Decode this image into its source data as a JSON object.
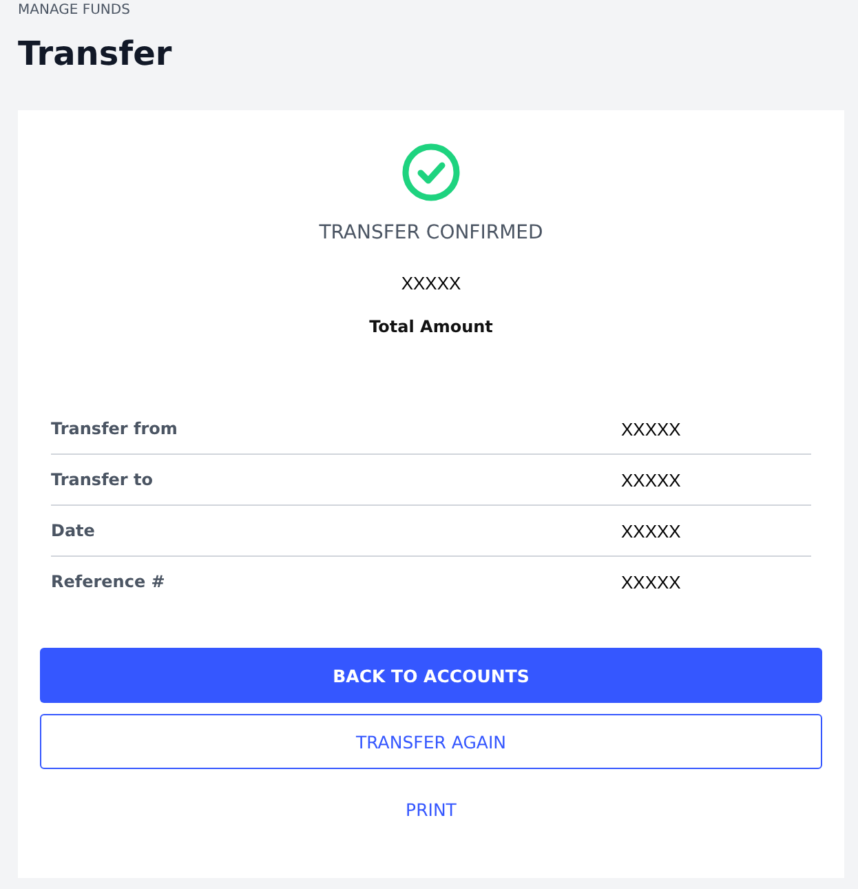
{
  "breadcrumb": "MANAGE FUNDS",
  "title": "Transfer",
  "status": "TRANSFER CONFIRMED",
  "amount": "XXXXX",
  "amount_label": "Total Amount",
  "details": [
    {
      "label": "Transfer from",
      "value": "XXXXX"
    },
    {
      "label": "Transfer to",
      "value": "XXXXX"
    },
    {
      "label": "Date",
      "value": "XXXXX"
    },
    {
      "label": "Reference #",
      "value": "XXXXX"
    }
  ],
  "buttons": [
    {
      "label": "BACK TO ACCOUNTS",
      "kind": "primary"
    },
    {
      "label": "TRANSFER AGAIN",
      "kind": "outline"
    },
    {
      "label": "PRINT",
      "kind": "text"
    }
  ]
}
